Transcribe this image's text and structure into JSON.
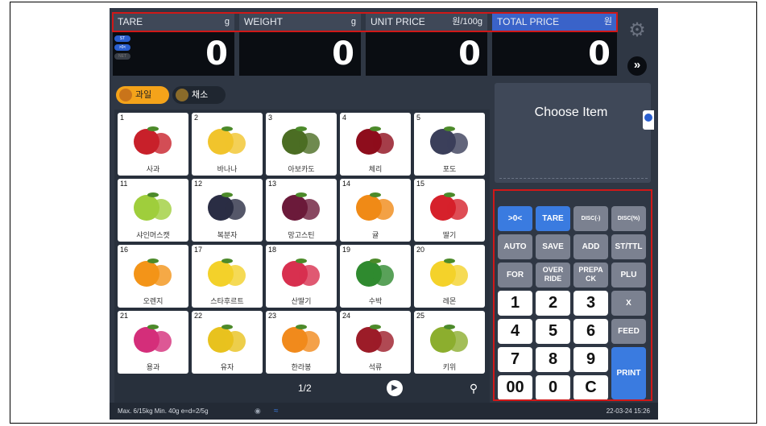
{
  "display": {
    "labels": [
      {
        "text": "TARE",
        "unit": "g"
      },
      {
        "text": "WEIGHT",
        "unit": "g"
      },
      {
        "text": "UNIT PRICE",
        "unit": "원/100g"
      },
      {
        "text": "TOTAL PRICE",
        "unit": "원"
      }
    ],
    "values": [
      "0",
      "0",
      "0",
      "0"
    ],
    "badges": [
      "ST",
      ">0<",
      "NET"
    ]
  },
  "icons": {
    "settings": "gear-icon",
    "more": "double-chevron-icon",
    "next_page": "play-icon",
    "search": "search-icon"
  },
  "more_label": "»",
  "categories": [
    {
      "label": "과일",
      "selected": true
    },
    {
      "label": "채소",
      "selected": false
    }
  ],
  "items": [
    {
      "num": "1",
      "name": "사과",
      "color": "#c8202a"
    },
    {
      "num": "2",
      "name": "바나나",
      "color": "#f1c42c"
    },
    {
      "num": "3",
      "name": "아보카도",
      "color": "#4b6d23"
    },
    {
      "num": "4",
      "name": "체리",
      "color": "#8e0d1c"
    },
    {
      "num": "5",
      "name": "포도",
      "color": "#3b3f5a"
    },
    {
      "num": "11",
      "name": "샤인머스캣",
      "color": "#9fce3c"
    },
    {
      "num": "12",
      "name": "복분자",
      "color": "#2a2d44"
    },
    {
      "num": "13",
      "name": "망고스틴",
      "color": "#6b1a3a"
    },
    {
      "num": "14",
      "name": "귤",
      "color": "#f08a16"
    },
    {
      "num": "15",
      "name": "딸기",
      "color": "#d6212b"
    },
    {
      "num": "16",
      "name": "오렌지",
      "color": "#f39418"
    },
    {
      "num": "17",
      "name": "스타후르트",
      "color": "#f3d12a"
    },
    {
      "num": "18",
      "name": "산딸기",
      "color": "#d8304f"
    },
    {
      "num": "19",
      "name": "수박",
      "color": "#2f8a2f"
    },
    {
      "num": "20",
      "name": "레몬",
      "color": "#f4d22a"
    },
    {
      "num": "21",
      "name": "용과",
      "color": "#d42e7a"
    },
    {
      "num": "22",
      "name": "유자",
      "color": "#e8c21e"
    },
    {
      "num": "23",
      "name": "한라봉",
      "color": "#f18a1c"
    },
    {
      "num": "24",
      "name": "석류",
      "color": "#9c1c28"
    },
    {
      "num": "25",
      "name": "키위",
      "color": "#8cae2e"
    }
  ],
  "pager": {
    "text": "1/2"
  },
  "choose": {
    "text": "Choose Item"
  },
  "keys": {
    "zero": ">0<",
    "tare": "TARE",
    "disc_minus": "DISC(-)",
    "disc_pct": "DISC(%)",
    "auto": "AUTO",
    "save": "SAVE",
    "add": "ADD",
    "stttl": "ST/TTL",
    "for": "FOR",
    "override_1": "OVER",
    "override_2": "RIDE",
    "prepack_1": "PREPA",
    "prepack_2": "CK",
    "plu": "PLU",
    "d1": "1",
    "d2": "2",
    "d3": "3",
    "x": "X",
    "d4": "4",
    "d5": "5",
    "d6": "6",
    "feed": "FEED",
    "d7": "7",
    "d8": "8",
    "d9": "9",
    "d00": "00",
    "d0": "0",
    "c": "C",
    "print": "PRINT"
  },
  "footer": {
    "spec": "Max. 6/15kg  Min. 40g  e=d=2/5g",
    "clock": "22-03-24 15:26"
  }
}
